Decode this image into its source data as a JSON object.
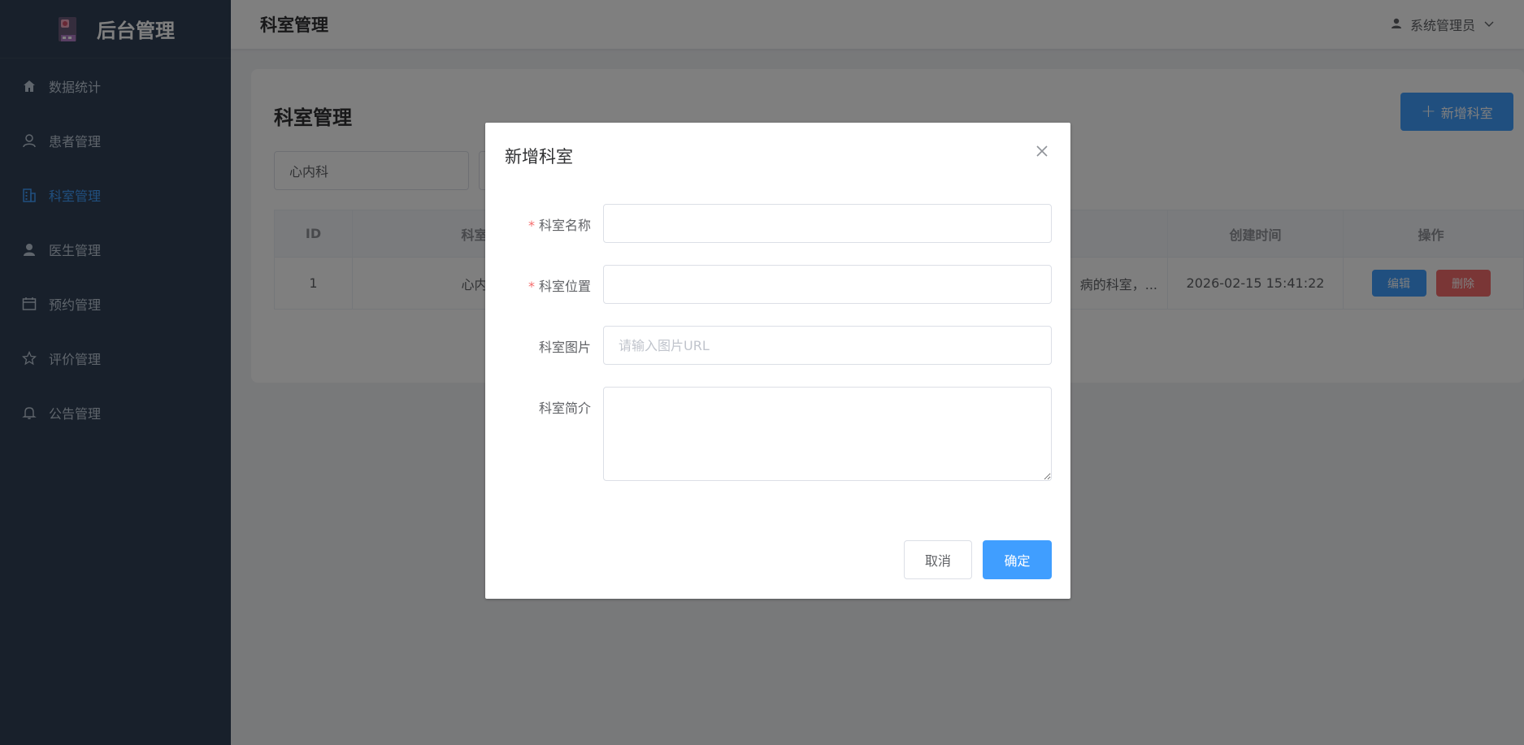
{
  "colors": {
    "sidebar_bg": "#304156",
    "primary": "#409eff",
    "danger": "#f56c6c"
  },
  "sidebar": {
    "logo_title": "后台管理",
    "items": [
      {
        "label": "数据统计",
        "icon": "home-icon"
      },
      {
        "label": "患者管理",
        "icon": "user-outline-icon"
      },
      {
        "label": "科室管理",
        "icon": "building-icon",
        "active": true
      },
      {
        "label": "医生管理",
        "icon": "user-solid-icon"
      },
      {
        "label": "预约管理",
        "icon": "calendar-icon"
      },
      {
        "label": "评价管理",
        "icon": "star-icon"
      },
      {
        "label": "公告管理",
        "icon": "bell-icon"
      }
    ]
  },
  "header": {
    "title": "科室管理",
    "user": "系统管理员"
  },
  "card": {
    "title": "科室管理",
    "add_button": "新增科室",
    "search_value": "心内科",
    "table": {
      "headers": [
        "ID",
        "科室",
        "",
        "",
        "创建时间",
        "操作"
      ],
      "rows": [
        {
          "id": "1",
          "name": "心内",
          "desc": "病的科室，...",
          "created": "2026-02-15 15:41:22",
          "edit": "编辑",
          "delete": "删除"
        }
      ]
    }
  },
  "dialog": {
    "title": "新增科室",
    "fields": {
      "name_label": "科室名称",
      "location_label": "科室位置",
      "image_label": "科室图片",
      "image_placeholder": "请输入图片URL",
      "intro_label": "科室简介",
      "required_mark": "*"
    },
    "cancel": "取消",
    "confirm": "确定"
  }
}
